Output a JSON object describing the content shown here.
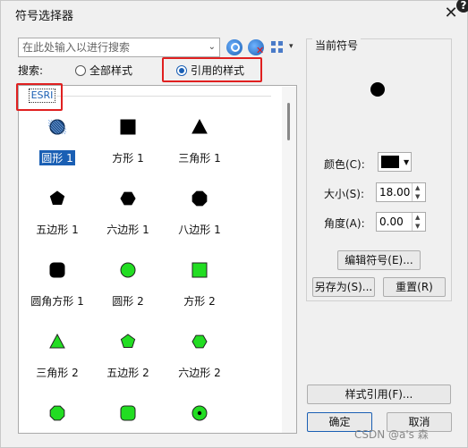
{
  "window": {
    "title": "符号选择器",
    "close_glyph": "✕"
  },
  "search": {
    "placeholder": "在此处输入以进行搜索"
  },
  "toolbar": {
    "search_icon": "search-icon",
    "clear_icon": "clear-search-icon",
    "view_icon": "grid-view-icon"
  },
  "filter": {
    "label": "搜索:",
    "options": [
      {
        "label": "全部样式",
        "selected": false
      },
      {
        "label": "引用的样式",
        "selected": true
      }
    ]
  },
  "gallery": {
    "group": "ESRI",
    "items": [
      {
        "label": "圆形 1",
        "shape": "circle",
        "fill": "#1f4e8a",
        "pattern": true,
        "selected": true
      },
      {
        "label": "方形 1",
        "shape": "square",
        "fill": "#000000"
      },
      {
        "label": "三角形 1",
        "shape": "triangle",
        "fill": "#000000"
      },
      {
        "label": "五边形 1",
        "shape": "pentagon",
        "fill": "#000000"
      },
      {
        "label": "六边形 1",
        "shape": "hexagon",
        "fill": "#000000"
      },
      {
        "label": "八边形 1",
        "shape": "octagon",
        "fill": "#000000"
      },
      {
        "label": "圆角方形 1",
        "shape": "rounded-square",
        "fill": "#000000"
      },
      {
        "label": "圆形 2",
        "shape": "circle",
        "fill": "#22dd22"
      },
      {
        "label": "方形 2",
        "shape": "square",
        "fill": "#22dd22"
      },
      {
        "label": "三角形 2",
        "shape": "triangle",
        "fill": "#22dd22"
      },
      {
        "label": "五边形 2",
        "shape": "pentagon",
        "fill": "#22dd22"
      },
      {
        "label": "六边形 2",
        "shape": "hexagon",
        "fill": "#22dd22"
      },
      {
        "label": "",
        "shape": "octagon",
        "fill": "#22dd22"
      },
      {
        "label": "",
        "shape": "rounded-square",
        "fill": "#22dd22"
      },
      {
        "label": "",
        "shape": "circle-dot",
        "fill": "#22dd22"
      }
    ]
  },
  "current_symbol": {
    "title": "当前符号",
    "color_label": "颜色(C):",
    "color_value": "#000000",
    "size_label": "大小(S):",
    "size_value": "18.00",
    "angle_label": "角度(A):",
    "angle_value": "0.00",
    "edit_button": "编辑符号(E)...",
    "save_as_button": "另存为(S)...",
    "reset_button": "重置(R)"
  },
  "footer": {
    "style_ref_button": "样式引用(F)...",
    "ok_button": "确定",
    "cancel_button": "取消"
  },
  "watermark": "CSDN @a's    森"
}
